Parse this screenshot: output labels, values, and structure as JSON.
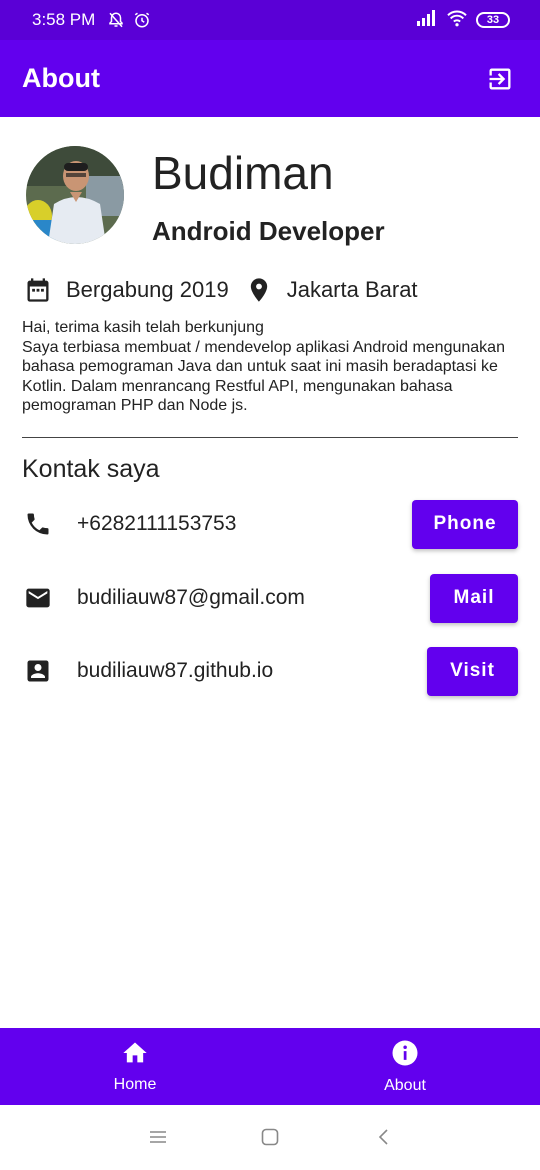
{
  "status_bar": {
    "time": "3:58 PM",
    "battery": "33"
  },
  "app_bar": {
    "title": "About",
    "action_icon": "logout-icon"
  },
  "profile": {
    "name": "Budiman",
    "role": "Android Developer",
    "joined": "Bergabung 2019",
    "location": "Jakarta Barat",
    "bio": "Hai, terima kasih telah berkunjung\nSaya terbiasa membuat / mendevelop aplikasi Android mengunakan bahasa pemograman Java dan untuk saat ini masih beradaptasi ke Kotlin. Dalam menrancang Restful API, mengunakan bahasa pemograman PHP dan Node js."
  },
  "contacts": {
    "title": "Kontak saya",
    "items": [
      {
        "icon": "phone-icon",
        "value": "+6282111153753",
        "button": "Phone"
      },
      {
        "icon": "mail-icon",
        "value": "budiliauw87@gmail.com",
        "button": "Mail"
      },
      {
        "icon": "contact-card-icon",
        "value": "budiliauw87.github.io",
        "button": "Visit"
      }
    ]
  },
  "bottom_nav": {
    "tabs": [
      {
        "icon": "home-icon",
        "label": "Home"
      },
      {
        "icon": "info-icon",
        "label": "About"
      }
    ]
  },
  "colors": {
    "primary": "#6200ee",
    "status_bar": "#5a00d6"
  }
}
